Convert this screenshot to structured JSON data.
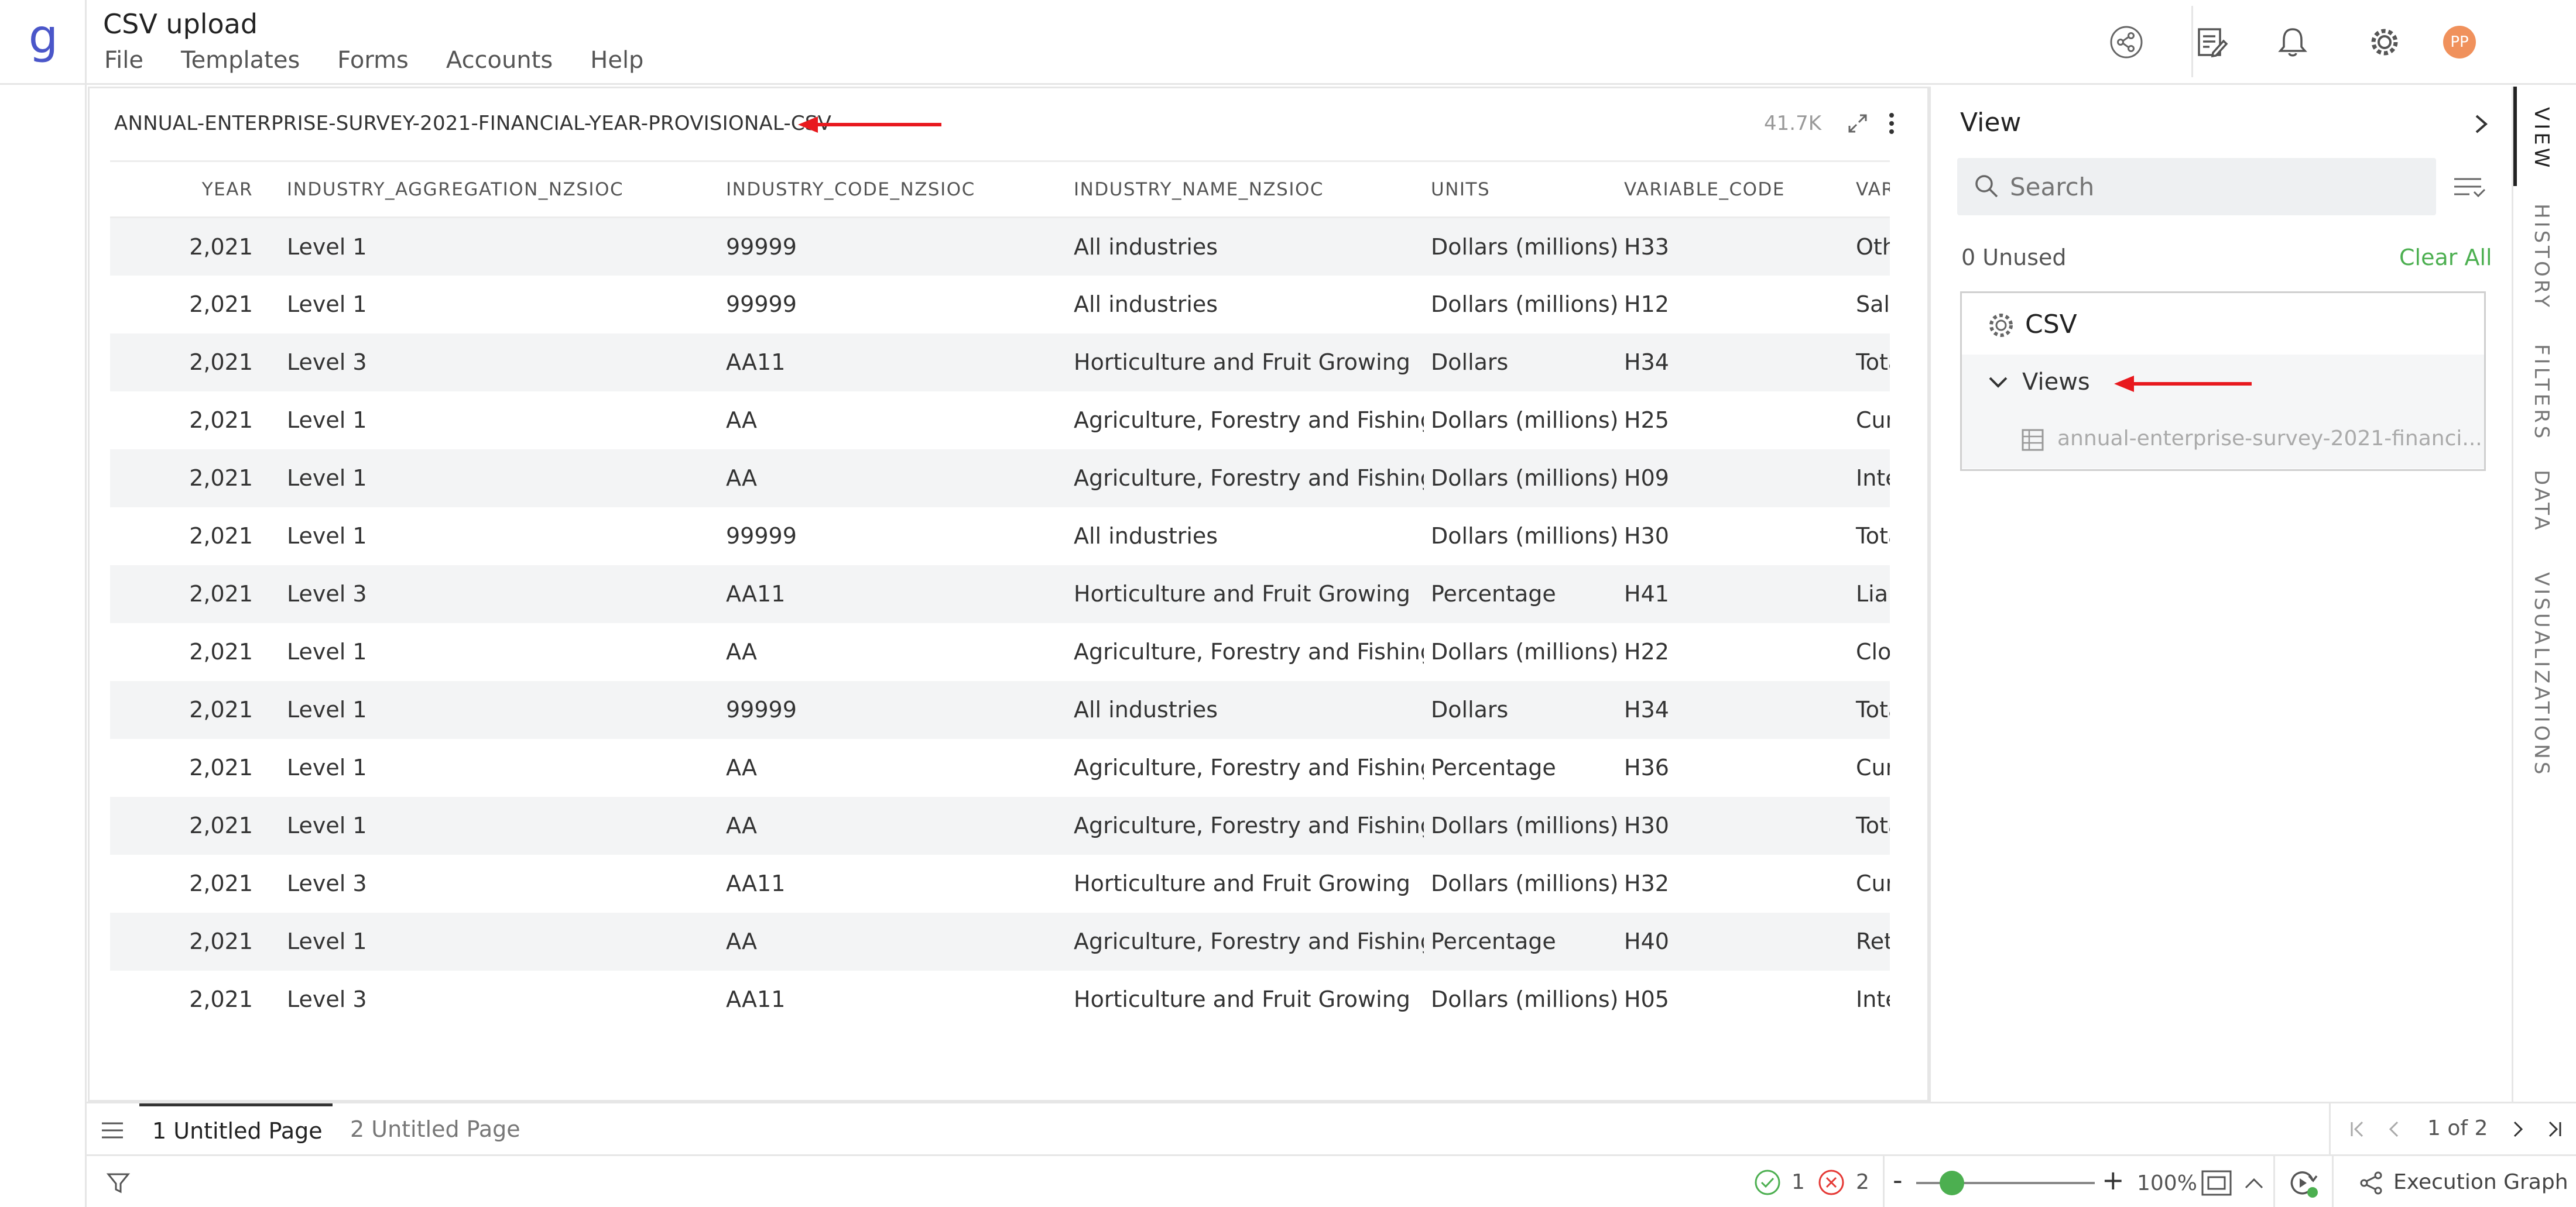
{
  "app": {
    "logo": "g",
    "title": "CSV upload",
    "menu": [
      "File",
      "Templates",
      "Forms",
      "Accounts",
      "Help"
    ],
    "avatar_initials": "PP",
    "accent_color": "#4caf50",
    "brand_color": "#4a56c9"
  },
  "main_panel": {
    "title": "ANNUAL-ENTERPRISE-SURVEY-2021-FINANCIAL-YEAR-PROVISIONAL-CSV",
    "row_count": "41.7K",
    "table": {
      "headers": [
        "YEAR",
        "INDUSTRY_AGGREGATION_NZSIOC",
        "INDUSTRY_CODE_NZSIOC",
        "INDUSTRY_NAME_NZSIOC",
        "UNITS",
        "VARIABLE_CODE",
        "VARIABLE_NAME"
      ],
      "rows": [
        [
          "2,021",
          "Level 1",
          "99999",
          "All industries",
          "Dollars (millions)",
          "H33",
          "Other"
        ],
        [
          "2,021",
          "Level 1",
          "99999",
          "All industries",
          "Dollars (millions)",
          "H12",
          "Salaries"
        ],
        [
          "2,021",
          "Level 3",
          "AA11",
          "Horticulture and Fruit Growing",
          "Dollars",
          "H34",
          "Total"
        ],
        [
          "2,021",
          "Level 1",
          "AA",
          "Agriculture, Forestry and Fishing",
          "Dollars (millions)",
          "H25",
          "Current"
        ],
        [
          "2,021",
          "Level 1",
          "AA",
          "Agriculture, Forestry and Fishing",
          "Dollars (millions)",
          "H09",
          "Interest"
        ],
        [
          "2,021",
          "Level 1",
          "99999",
          "All industries",
          "Dollars (millions)",
          "H30",
          "Total"
        ],
        [
          "2,021",
          "Level 3",
          "AA11",
          "Horticulture and Fruit Growing",
          "Percentage",
          "H41",
          "Liabilities"
        ],
        [
          "2,021",
          "Level 1",
          "AA",
          "Agriculture, Forestry and Fishing",
          "Dollars (millions)",
          "H22",
          "Closing"
        ],
        [
          "2,021",
          "Level 1",
          "99999",
          "All industries",
          "Dollars",
          "H34",
          "Total"
        ],
        [
          "2,021",
          "Level 1",
          "AA",
          "Agriculture, Forestry and Fishing",
          "Percentage",
          "H36",
          "Current"
        ],
        [
          "2,021",
          "Level 1",
          "AA",
          "Agriculture, Forestry and Fishing",
          "Dollars (millions)",
          "H30",
          "Total"
        ],
        [
          "2,021",
          "Level 3",
          "AA11",
          "Horticulture and Fruit Growing",
          "Dollars (millions)",
          "H32",
          "Current"
        ],
        [
          "2,021",
          "Level 1",
          "AA",
          "Agriculture, Forestry and Fishing",
          "Percentage",
          "H40",
          "Return"
        ],
        [
          "2,021",
          "Level 3",
          "AA11",
          "Horticulture and Fruit Growing",
          "Dollars (millions)",
          "H05",
          "Interest"
        ]
      ]
    }
  },
  "side_panel": {
    "title": "View",
    "search_placeholder": "Search",
    "unused_label": "0 Unused",
    "clear_all": "Clear All",
    "tree": {
      "root": "CSV",
      "group": "Views",
      "item": "annual-enterprise-survey-2021-financi..."
    }
  },
  "vertical_tabs": [
    "VIEW",
    "HISTORY",
    "FILTERS",
    "DATA",
    "VISUALIZATIONS"
  ],
  "pages": {
    "tabs": [
      "1 Untitled Page",
      "2 Untitled Page"
    ],
    "pager": "1 of 2"
  },
  "status_bar": {
    "ok_count": "1",
    "error_count": "2",
    "zoom_minus": "-",
    "zoom_plus": "+",
    "zoom_level": "100%",
    "zoom_fraction": 0.2,
    "execution_graph": "Execution Graph"
  }
}
